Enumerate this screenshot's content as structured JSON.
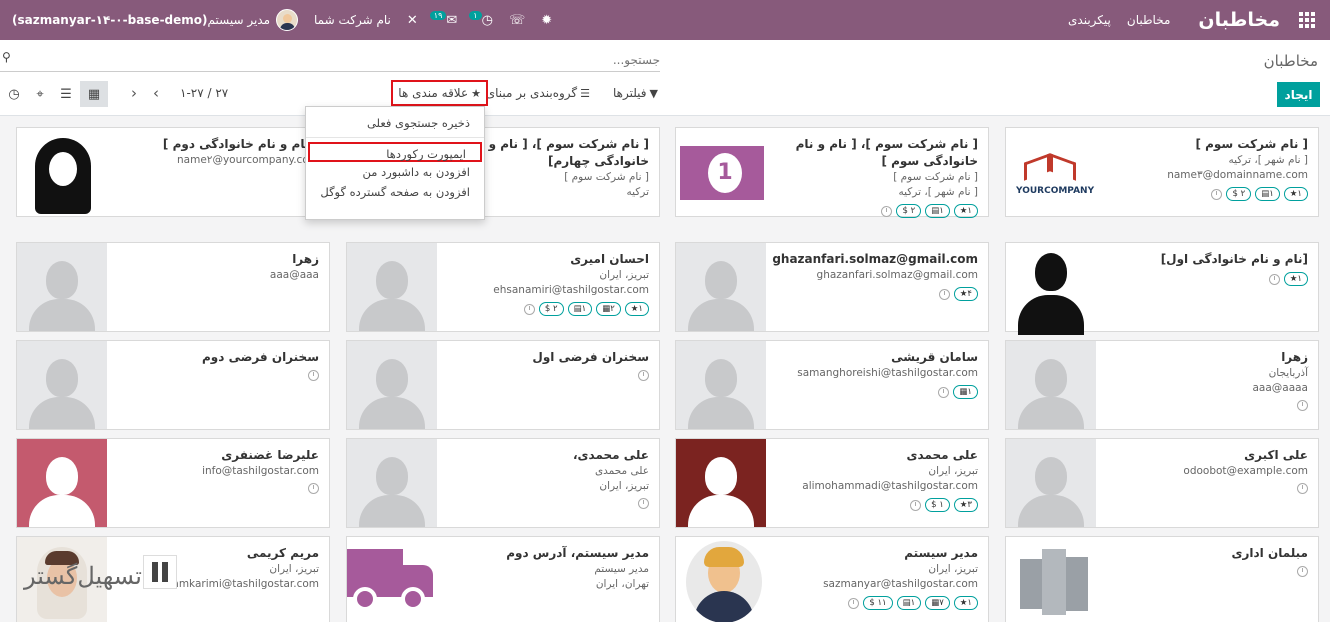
{
  "navbar": {
    "brand": "مخاطبان",
    "menus": [
      "مخاطبان",
      "پیکربندی"
    ],
    "company": "نام شرکت شما",
    "user": "مدیر سیستم",
    "db": "(sazmanyar-۱۴-۰-base-demo)",
    "activity_badge": "۱",
    "discuss_badge": "۱۹"
  },
  "control": {
    "breadcrumb": "مخاطبان",
    "search_placeholder": "جستجو...",
    "create": "ایجاد",
    "filters": "فیلترها",
    "groupby": "گروه‌بندی بر مبنای",
    "favorites": "علاقه مندی ها",
    "pager": "۱-۲۷ / ۲۷"
  },
  "favorites_menu": {
    "save": "ذخیره جستجوی فعلی",
    "import": "ایمپورت رکوردها",
    "dashboard": "افزودن به داشبورد من",
    "spreadsheet": "افزودن به صفحه گسترده گوگل"
  },
  "cards": [
    {
      "name": "[ نام شرکت سوم ]",
      "lines": [
        "[ نام شهر ]، ترکیه",
        "name۳@domainname.com"
      ],
      "tags": [
        "۱★",
        "۱▤",
        "۲ $"
      ]
    },
    {
      "name": "[ نام شرکت سوم ]، [ نام و نام خانوادگی سوم ]",
      "lines": [
        "[ نام شرکت سوم ]",
        "[ نام شهر ]، ترکیه"
      ],
      "tags": [
        "۱★",
        "۱▤",
        "۲ $"
      ]
    },
    {
      "name": "[ نام شرکت سوم ]، [ نام و نام خانوادگی چهارم]",
      "lines": [
        "[ نام شرکت سوم ]",
        "ترکیه"
      ],
      "tags": []
    },
    {
      "name": "[ نام و نام خانوادگی دوم ]",
      "lines": [
        "name۲@yourcompany.com"
      ],
      "tags": []
    },
    {
      "name": "[نام و نام خانوادگی اول]",
      "lines": [],
      "tags": [
        "۱★"
      ]
    },
    {
      "name": "ghazanfari.solmaz@gmail.com",
      "lines": [
        "ghazanfari.solmaz@gmail.com"
      ],
      "tags": [
        "۴★"
      ]
    },
    {
      "name": "احسان امیری",
      "lines": [
        "تبریز، ایران",
        "ehsanamiri@tashilgostar.com"
      ],
      "tags": [
        "۱★",
        "۲▦",
        "۱▤",
        "۲ $"
      ]
    },
    {
      "name": "زهرا",
      "lines": [
        "aaa@aaa"
      ],
      "tags": []
    },
    {
      "name": "زهرا",
      "lines": [
        "آذربایجان",
        "aaa@aaaa"
      ],
      "tags": []
    },
    {
      "name": "سامان قریشی",
      "lines": [
        "samanghoreishi@tashilgostar.com"
      ],
      "tags": [
        "۱▦"
      ]
    },
    {
      "name": "سخنران فرضی اول",
      "lines": [],
      "tags": []
    },
    {
      "name": "سخنران فرضی دوم",
      "lines": [],
      "tags": []
    },
    {
      "name": "علی اکبری",
      "lines": [
        "odoobot@example.com"
      ],
      "tags": []
    },
    {
      "name": "علی محمدی",
      "lines": [
        "تبریز، ایران",
        "alimohammadi@tashilgostar.com"
      ],
      "tags": [
        "۳★",
        "۱ $"
      ]
    },
    {
      "name": "علی محمدی،",
      "lines": [
        "علی محمدی",
        "تبریز، ایران"
      ],
      "tags": []
    },
    {
      "name": "علیرضا غضنفری",
      "lines": [
        "info@tashilgostar.com"
      ],
      "tags": []
    },
    {
      "name": "مبلمان اداری",
      "lines": [],
      "tags": []
    },
    {
      "name": "مدیر سیستم",
      "lines": [
        "تبریز، ایران",
        "sazmanyar@tashilgostar.com"
      ],
      "tags": [
        "۱★",
        "۷▦",
        "۱▤",
        "۱۱ $"
      ]
    },
    {
      "name": "مدیر سیستم، آدرس دوم",
      "lines": [
        "مدیر سیستم",
        "تهران، ایران"
      ],
      "tags": []
    },
    {
      "name": "مریم کریمی",
      "lines": [
        "تبریز، ایران",
        "maryamkarimi@tashilgostar.com"
      ],
      "tags": []
    }
  ],
  "watermark": "تسهیل‌گستر"
}
